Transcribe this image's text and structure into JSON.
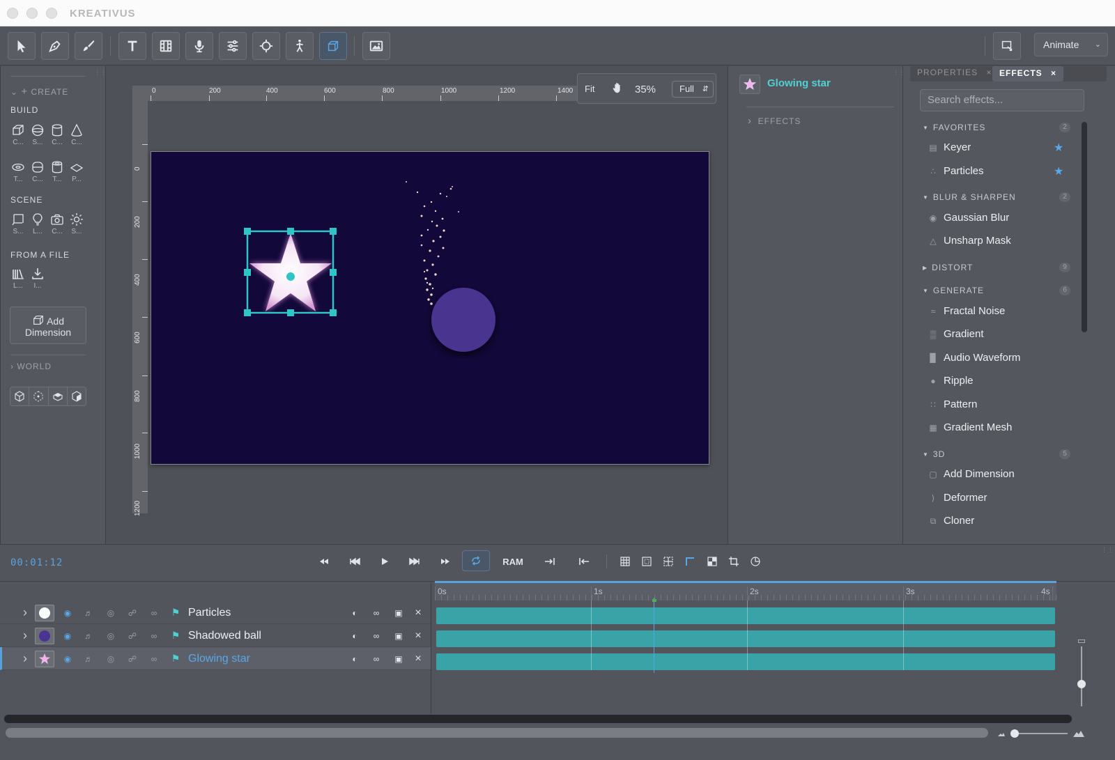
{
  "app": {
    "title": "KREATIVUS"
  },
  "toolbar": {
    "tools": [
      "select-tool",
      "pen-tool",
      "brush-tool",
      "text-tool",
      "film-tool",
      "audio-tool",
      "adjust-tool",
      "target-tool",
      "puppet-tool",
      "3d-tool",
      "image-tool"
    ],
    "active_tool": "3d-tool",
    "mode_label": "Animate"
  },
  "create_panel": {
    "header": "CREATE",
    "build_label": "BUILD",
    "build_items": [
      {
        "caption": "C...",
        "icon": "cube-icon"
      },
      {
        "caption": "S...",
        "icon": "sphere-icon"
      },
      {
        "caption": "C...",
        "icon": "cylinder-icon"
      },
      {
        "caption": "C...",
        "icon": "cone-icon"
      },
      {
        "caption": "T...",
        "icon": "torus-icon"
      },
      {
        "caption": "C...",
        "icon": "capsule-icon"
      },
      {
        "caption": "T...",
        "icon": "tube-icon"
      },
      {
        "caption": "P...",
        "icon": "plane-icon"
      }
    ],
    "scene_label": "SCENE",
    "scene_items": [
      {
        "caption": "S...",
        "icon": "stage-icon"
      },
      {
        "caption": "L...",
        "icon": "light-icon"
      },
      {
        "caption": "C...",
        "icon": "camera-icon"
      },
      {
        "caption": "S...",
        "icon": "sun-icon"
      }
    ],
    "file_label": "FROM A FILE",
    "file_items": [
      {
        "caption": "L...",
        "icon": "library-icon"
      },
      {
        "caption": "I...",
        "icon": "import-icon"
      }
    ],
    "add_dimension_label": "Add Dimension",
    "world_label": "WORLD"
  },
  "viewer": {
    "ruler_h": [
      "0",
      "200",
      "400",
      "600",
      "800",
      "1000",
      "1200",
      "1400"
    ],
    "ruler_v": [
      "0",
      "200",
      "400",
      "600",
      "800",
      "1000",
      "1200"
    ],
    "fit_label": "Fit",
    "zoom": "35%",
    "resolution": "Full",
    "background_color": "#12083a",
    "selection_color": "#2ec4c8"
  },
  "layer_effects_panel": {
    "layer_name": "Glowing star",
    "effects_label": "EFFECTS"
  },
  "effects_browser": {
    "tabs": [
      {
        "label": "PROPERTIES",
        "active": false
      },
      {
        "label": "EFFECTS",
        "active": true
      }
    ],
    "search_placeholder": "Search effects...",
    "categories": [
      {
        "name": "FAVORITES",
        "count": "2",
        "expanded": true,
        "items": [
          {
            "label": "Keyer",
            "icon": "keyer-icon",
            "favorite": true
          },
          {
            "label": "Particles",
            "icon": "particles-icon",
            "favorite": true
          }
        ]
      },
      {
        "name": "BLUR & SHARPEN",
        "count": "2",
        "expanded": true,
        "items": [
          {
            "label": "Gaussian Blur",
            "icon": "blur-icon"
          },
          {
            "label": "Unsharp Mask",
            "icon": "sharpen-icon"
          }
        ]
      },
      {
        "name": "DISTORT",
        "count": "9",
        "expanded": false,
        "items": []
      },
      {
        "name": "GENERATE",
        "count": "6",
        "expanded": true,
        "items": [
          {
            "label": "Fractal Noise",
            "icon": "noise-icon"
          },
          {
            "label": "Gradient",
            "icon": "gradient-icon"
          },
          {
            "label": "Audio Waveform",
            "icon": "waveform-icon"
          },
          {
            "label": "Ripple",
            "icon": "ripple-icon"
          },
          {
            "label": "Pattern",
            "icon": "pattern-icon"
          },
          {
            "label": "Gradient Mesh",
            "icon": "mesh-icon"
          }
        ]
      },
      {
        "name": "3D",
        "count": "5",
        "expanded": true,
        "items": [
          {
            "label": "Add Dimension",
            "icon": "dimension-icon"
          },
          {
            "label": "Deformer",
            "icon": "deformer-icon"
          },
          {
            "label": "Cloner",
            "icon": "cloner-icon"
          }
        ]
      }
    ],
    "favorite_color": "#5aa7e8"
  },
  "timeline": {
    "timecode": "00:01:12",
    "ram_label": "RAM",
    "ruler": [
      "0s",
      "1s",
      "2s",
      "3s",
      "4s"
    ],
    "track_color": "#3aa3a8",
    "layers": [
      {
        "name": "Particles",
        "thumb": "white-dot",
        "selected": false
      },
      {
        "name": "Shadowed ball",
        "thumb": "purple-dot",
        "selected": false
      },
      {
        "name": "Glowing star",
        "thumb": "star",
        "selected": true
      }
    ]
  }
}
